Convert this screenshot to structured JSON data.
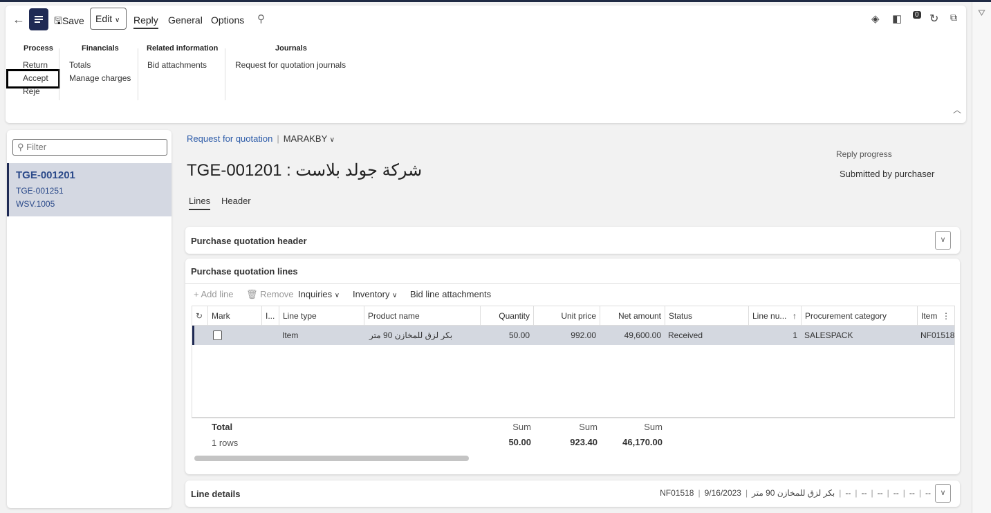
{
  "toolbar": {
    "save": "Save",
    "edit": "Edit",
    "tabs": [
      "Reply",
      "General",
      "Options"
    ]
  },
  "ribbon": {
    "groups": [
      {
        "title": "Process",
        "items": [
          "Return",
          "Accept",
          "Reje"
        ]
      },
      {
        "title": "Financials",
        "items": [
          "Totals",
          "Manage charges"
        ]
      },
      {
        "title": "Related information",
        "items": [
          "Bid attachments"
        ]
      },
      {
        "title": "Journals",
        "items": [
          "Request for quotation journals"
        ]
      }
    ],
    "notification_count": "0"
  },
  "list": {
    "filter_placeholder": "Filter",
    "selected": {
      "title": "TGE-001201",
      "line2": "TGE-001251",
      "line3": "WSV.1005"
    }
  },
  "main": {
    "breadcrumb": "Request for quotation",
    "company": "MARAKBY",
    "title": "TGE-001201 : شركة جولد بلاست",
    "reply_progress_label": "Reply progress",
    "reply_progress_value": "Submitted by purchaser",
    "tabs": [
      "Lines",
      "Header"
    ],
    "header_section": "Purchase quotation header",
    "lines_section": "Purchase quotation lines",
    "line_toolbar": {
      "add": "Add line",
      "remove": "Remove",
      "inquiries": "Inquiries",
      "inventory": "Inventory",
      "attachments": "Bid line attachments"
    },
    "columns": [
      "Mark",
      "I...",
      "Line type",
      "Product name",
      "Quantity",
      "Unit price",
      "Net amount",
      "Status",
      "Line nu...",
      "Procurement category",
      "Item"
    ],
    "rows": [
      {
        "type": "Item",
        "product": "بكر لزق للمخازن 90 متر",
        "quantity": "50.00",
        "unit_price": "992.00",
        "net_amount": "49,600.00",
        "status": "Received",
        "line_number": "1",
        "category": "SALESPACK",
        "item": "NF01518"
      }
    ],
    "footer": {
      "total": "Total",
      "rows": "1 rows",
      "sum_label": "Sum",
      "sum_quantity": "50.00",
      "sum_unit_price": "923.40",
      "sum_net_amount": "46,170.00"
    },
    "line_details": {
      "title": "Line details",
      "summary": [
        "NF01518",
        "بكر لزق للمخازن 90 متر",
        "9/16/2023",
        "--",
        "--",
        "--",
        "--",
        "--",
        "--"
      ]
    }
  }
}
